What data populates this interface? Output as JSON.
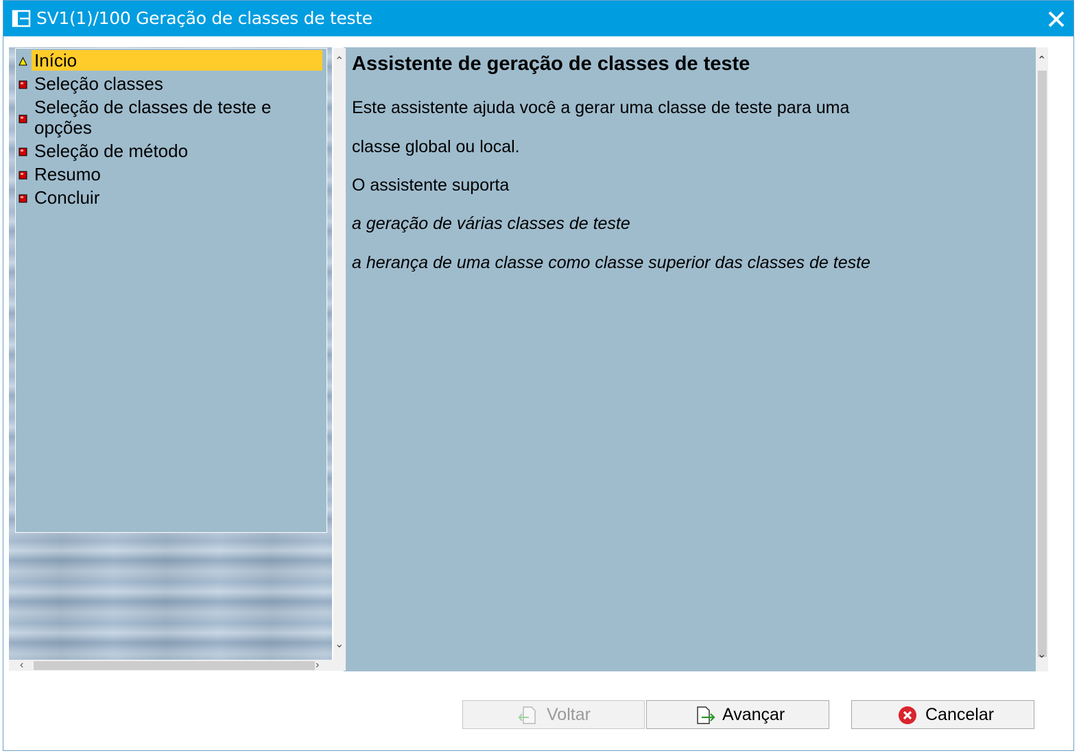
{
  "window": {
    "title": "SV1(1)/100 Geração de classes de teste",
    "title_icon": "window-menu-icon",
    "close_icon": "close-icon"
  },
  "steps": [
    {
      "label": "Início",
      "status": "current",
      "icon": "yellow-triangle-icon"
    },
    {
      "label": "Seleção classes",
      "status": "pending",
      "icon": "red-square-icon"
    },
    {
      "label": "Seleção de classes de teste e",
      "label2": "opções",
      "status": "pending",
      "icon": "red-square-icon"
    },
    {
      "label": "Seleção de método",
      "status": "pending",
      "icon": "red-square-icon"
    },
    {
      "label": "Resumo",
      "status": "pending",
      "icon": "red-square-icon"
    },
    {
      "label": "Concluir",
      "status": "pending",
      "icon": "red-square-icon"
    }
  ],
  "content": {
    "heading": "Assistente de geração de classes de teste",
    "line1": "Este assistente ajuda você a gerar uma classe de teste para uma",
    "line2": "classe global ou local.",
    "line3": "O assistente suporta",
    "line4": "a geração de várias classes de teste",
    "line5": "a herança de uma classe como classe superior das classes de teste"
  },
  "buttons": {
    "back": {
      "label": "Voltar",
      "enabled": false,
      "icon": "back-arrow-icon"
    },
    "next": {
      "label": "Avançar",
      "enabled": true,
      "icon": "forward-arrow-icon"
    },
    "cancel": {
      "label": "Cancelar",
      "enabled": true,
      "icon": "cancel-icon"
    }
  },
  "colors": {
    "titlebar": "#009de0",
    "panel": "#9fbccd",
    "highlight": "#ffcc29",
    "status_pending": "#cc0000",
    "status_current": "#ffe000"
  }
}
